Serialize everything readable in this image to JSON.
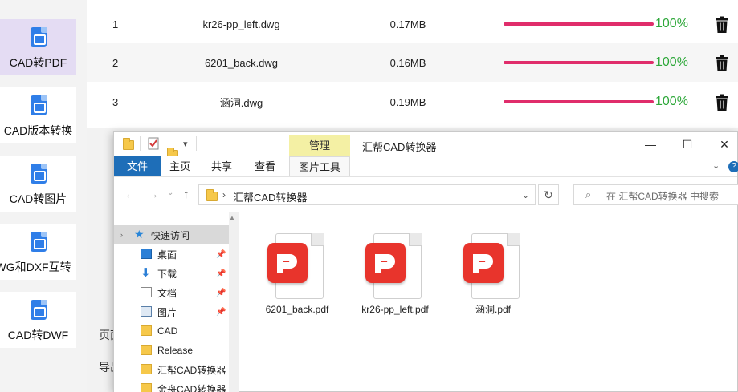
{
  "sidebar": {
    "items": [
      {
        "label": "CAD转PDF",
        "active": true
      },
      {
        "label": "CAD版本转换",
        "active": false
      },
      {
        "label": "CAD转图片",
        "active": false
      },
      {
        "label": "DWG和DXF互转",
        "active": false
      },
      {
        "label": "CAD转DWF",
        "active": false
      }
    ],
    "partial_labels": [
      "页面",
      "导出"
    ]
  },
  "files": [
    {
      "index": "1",
      "name": "kr26-pp_left.dwg",
      "size": "0.17MB",
      "progress_pct": 100,
      "progress_text": "100%"
    },
    {
      "index": "2",
      "name": "6201_back.dwg",
      "size": "0.16MB",
      "progress_pct": 100,
      "progress_text": "100%"
    },
    {
      "index": "3",
      "name": "涵洞.dwg",
      "size": "0.19MB",
      "progress_pct": 100,
      "progress_text": "100%"
    }
  ],
  "colors": {
    "accent_active": "#e4dcf3",
    "progress_bar": "#e02d6b",
    "progress_text": "#2ea83a",
    "explorer_file_tab": "#1e6eb8",
    "manage_tab": "#f4f0a4",
    "pdf_logo": "#e8342c"
  },
  "explorer": {
    "title": "汇帮CAD转换器",
    "manage_tab": "管理",
    "window_buttons": {
      "minimize": "—",
      "maximize": "☐",
      "close": "✕"
    },
    "ribbon_tabs": [
      "文件",
      "主页",
      "共享",
      "查看",
      "图片工具"
    ],
    "address": {
      "path": "汇帮CAD转换器",
      "search_placeholder": "在 汇帮CAD转换器 中搜索"
    },
    "nav": [
      {
        "label": "快速访问",
        "icon": "star-icon",
        "pinned": false
      },
      {
        "label": "桌面",
        "icon": "desktop-icon",
        "pinned": true
      },
      {
        "label": "下载",
        "icon": "download-icon",
        "pinned": true
      },
      {
        "label": "文档",
        "icon": "document-icon",
        "pinned": true
      },
      {
        "label": "图片",
        "icon": "picture-icon",
        "pinned": true
      },
      {
        "label": "CAD",
        "icon": "folder-icon",
        "pinned": false
      },
      {
        "label": "Release",
        "icon": "folder-icon",
        "pinned": false
      },
      {
        "label": "汇帮CAD转换器",
        "icon": "folder-icon",
        "pinned": false
      },
      {
        "label": "金舟CAD转换器",
        "icon": "folder-icon",
        "pinned": false
      }
    ],
    "files": [
      {
        "name": "6201_back.pdf",
        "icon": "pdf-file-icon"
      },
      {
        "name": "kr26-pp_left.pdf",
        "icon": "pdf-file-icon"
      },
      {
        "name": "涵洞.pdf",
        "icon": "pdf-file-icon"
      }
    ]
  }
}
